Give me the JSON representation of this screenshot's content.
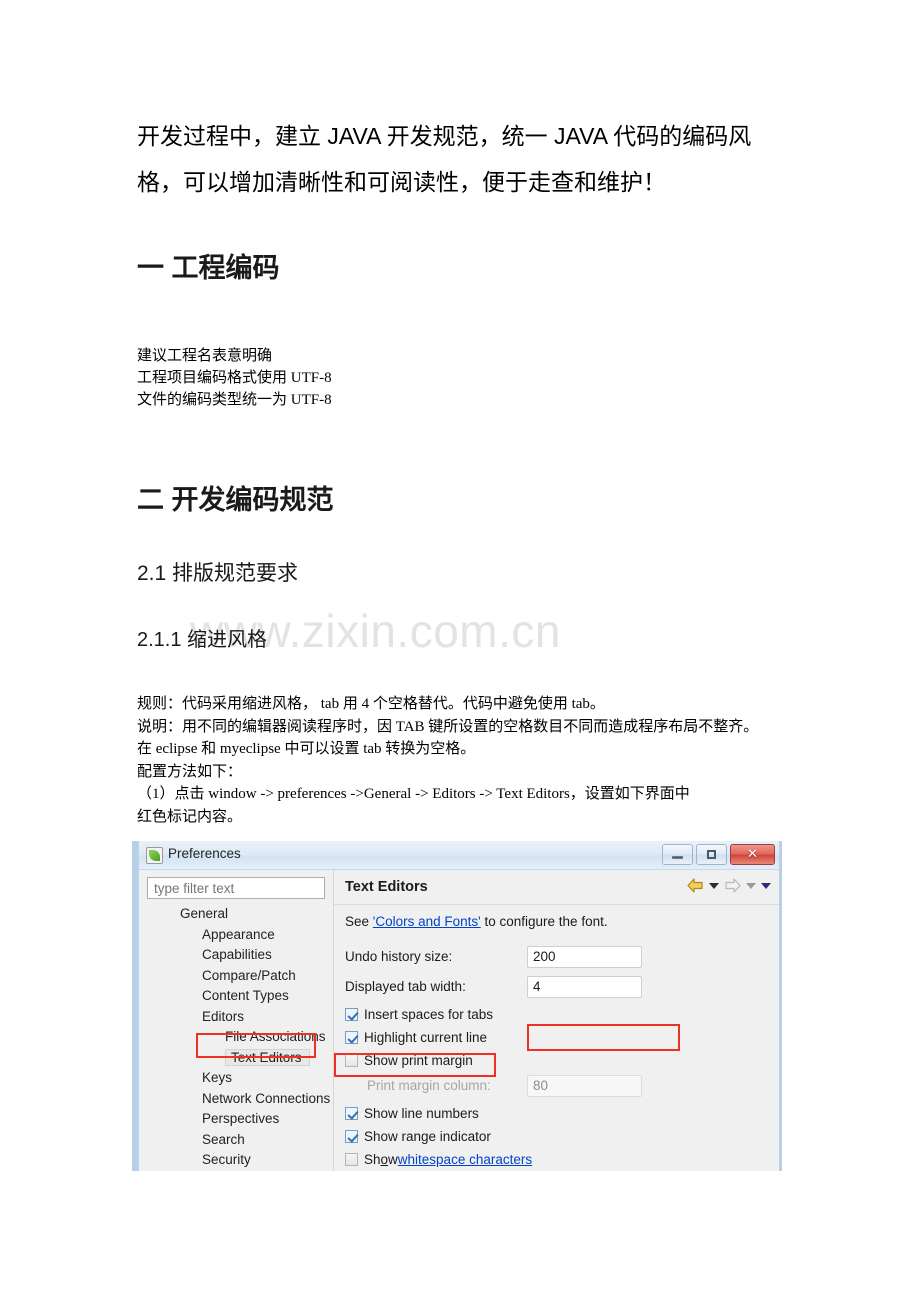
{
  "document": {
    "intro": "开发过程中，建立 JAVA 开发规范，统一 JAVA 代码的编码风格，可以增加清晰性和可阅读性，便于走查和维护！",
    "watermark": "www.zixin.com.cn",
    "section1": {
      "heading": "一  工程编码",
      "lines": [
        "建议工程名表意明确",
        "工程项目编码格式使用 UTF-8",
        "文件的编码类型统一为 UTF-8"
      ]
    },
    "section2": {
      "heading": "二  开发编码规范",
      "sub21": "2.1  排版规范要求",
      "sub211": "2.1.1  缩进风格",
      "paragraphs": [
        "规则：代码采用缩进风格， tab 用 4 个空格替代。代码中避免使用 tab。",
        "说明：用不同的编辑器阅读程序时，因 TAB 键所设置的空格数目不同而造成程序布局不整齐。",
        "在 eclipse 和 myeclipse 中可以设置 tab 转换为空格。",
        "配置方法如下：",
        "（1）点击 window -> preferences ->General -> Editors -> Text Editors，设置如下界面中",
        "红色标记内容。"
      ]
    }
  },
  "preferences_dialog": {
    "title": "Preferences",
    "window_buttons": {
      "minimize": "–",
      "maximize": "□",
      "close": "✕"
    },
    "filter": {
      "placeholder": "type filter text",
      "value": ""
    },
    "tree": [
      {
        "label": "General",
        "level": 1,
        "selected": false
      },
      {
        "label": "Appearance",
        "level": 2,
        "selected": false
      },
      {
        "label": "Capabilities",
        "level": 2,
        "selected": false
      },
      {
        "label": "Compare/Patch",
        "level": 2,
        "selected": false
      },
      {
        "label": "Content Types",
        "level": 2,
        "selected": false
      },
      {
        "label": "Editors",
        "level": 2,
        "selected": false
      },
      {
        "label": "File Associations",
        "level": 3,
        "selected": false
      },
      {
        "label": "Text Editors",
        "level": 3,
        "selected": true
      },
      {
        "label": "Keys",
        "level": 2,
        "selected": false
      },
      {
        "label": "Network Connections",
        "level": 2,
        "selected": false
      },
      {
        "label": "Perspectives",
        "level": 2,
        "selected": false
      },
      {
        "label": "Search",
        "level": 2,
        "selected": false
      },
      {
        "label": "Security",
        "level": 2,
        "selected": false
      }
    ],
    "panel": {
      "title": "Text Editors",
      "see_prefix": "See ",
      "see_link": "'Colors and Fonts'",
      "see_suffix": " to configure the font.",
      "fields": [
        {
          "label": "Undo history size:",
          "value": "200",
          "disabled": false
        },
        {
          "label": "Displayed tab width:",
          "value": "4",
          "disabled": false
        }
      ],
      "checkboxes": [
        {
          "label": "Insert spaces for tabs",
          "checked": true
        },
        {
          "label": "Highlight current line",
          "checked": true
        },
        {
          "label": "Show print margin",
          "checked": false
        }
      ],
      "print_margin": {
        "label": "Print margin column:",
        "value": "80",
        "disabled": true
      },
      "checkboxes2": [
        {
          "label": "Show line numbers",
          "checked": true
        },
        {
          "label": "Show range indicator",
          "checked": true
        }
      ],
      "whitespace_row": {
        "prefix": "Sh",
        "underlined": "o",
        "middle": "w ",
        "link": "whitespace characters",
        "checked": false
      }
    },
    "accent_colors": {
      "annotation_red": "#ee3124",
      "link_blue": "#0044cc",
      "close_red": "#cf4437",
      "window_border_blue": "#b8d0e8"
    }
  }
}
